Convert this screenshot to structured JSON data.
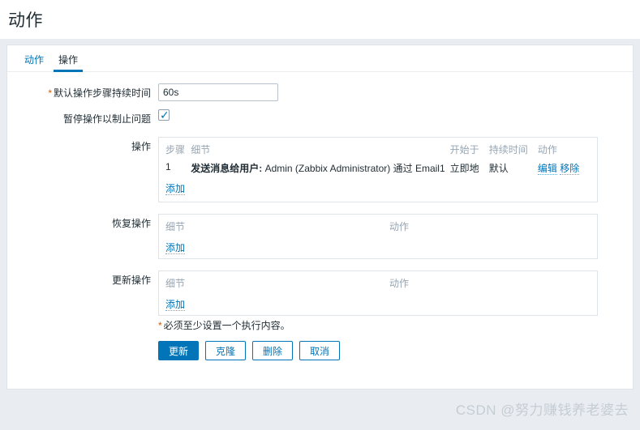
{
  "page": {
    "title": "动作"
  },
  "tabs": [
    {
      "label": "动作",
      "active": false
    },
    {
      "label": "操作",
      "active": true
    }
  ],
  "form": {
    "duration": {
      "label": "默认操作步骤持续时间",
      "required": true,
      "value": "60s",
      "placeholder": ""
    },
    "pause": {
      "label": "暂停操作以制止问题",
      "checked": true
    },
    "operations": {
      "label": "操作",
      "headers": {
        "step": "步骤",
        "details": "细节",
        "start_in": "开始于",
        "duration": "持续时间",
        "action": "动作"
      },
      "rows": [
        {
          "step": "1",
          "details_bold": "发送消息给用户:",
          "details_rest": "Admin (Zabbix Administrator) 通过 Email1",
          "start_in": "立即地",
          "duration": "默认",
          "edit_label": "编辑",
          "remove_label": "移除"
        }
      ],
      "add_label": "添加"
    },
    "recovery_operations": {
      "label": "恢复操作",
      "headers": {
        "details": "细节",
        "action": "动作"
      },
      "add_label": "添加"
    },
    "update_operations": {
      "label": "更新操作",
      "headers": {
        "details": "细节",
        "action": "动作"
      },
      "add_label": "添加"
    },
    "footnote": "必须至少设置一个执行内容。",
    "footnote_star": "*"
  },
  "buttons": {
    "update": "更新",
    "clone": "克隆",
    "delete": "删除",
    "cancel": "取消"
  },
  "watermark": "CSDN @努力赚钱养老婆去",
  "colors": {
    "accent": "#0275b8",
    "required": "#d65b00",
    "muted": "#97a5b3",
    "page_bg": "#e9edf2",
    "border": "#dfe4e9"
  }
}
